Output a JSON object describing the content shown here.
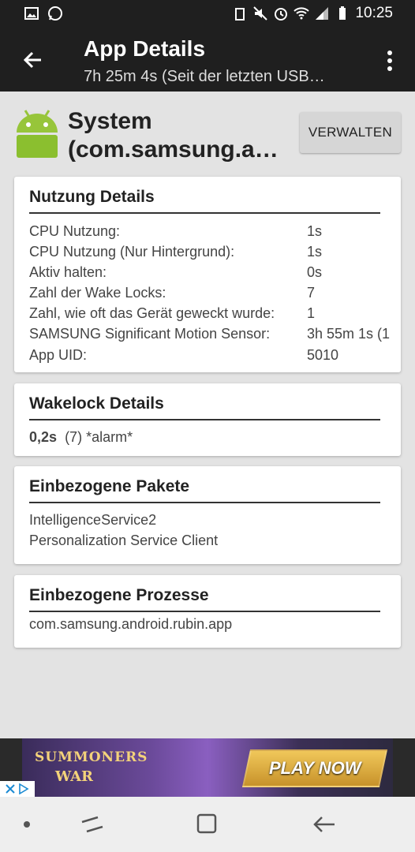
{
  "status": {
    "time": "10:25"
  },
  "appbar": {
    "title": "App Details",
    "subtitle": "7h 25m 4s (Seit der letzten USB…"
  },
  "header": {
    "name_line1": "System",
    "name_line2": "(com.samsung.a…",
    "manage_label": "VERWALTEN"
  },
  "usage": {
    "title": "Nutzung Details",
    "rows": [
      {
        "label": "CPU Nutzung:",
        "value": "1s"
      },
      {
        "label": "CPU Nutzung (Nur Hintergrund):",
        "value": "1s"
      },
      {
        "label": "Aktiv halten:",
        "value": "0s"
      },
      {
        "label": "Zahl der Wake Locks:",
        "value": "7"
      },
      {
        "label": "Zahl, wie oft das Gerät geweckt wurde:",
        "value": "1"
      },
      {
        "label": "SAMSUNG Significant Motion Sensor:",
        "value": "3h 55m 1s (1"
      },
      {
        "label": "App UID:",
        "value": "5010"
      }
    ]
  },
  "wakelock": {
    "title": "Wakelock Details",
    "time": "0,2s",
    "entry": "(7) *alarm*"
  },
  "packages": {
    "title": "Einbezogene Pakete",
    "items": [
      "IntelligenceService2",
      "Personalization Service Client"
    ]
  },
  "processes": {
    "title": "Einbezogene Prozesse",
    "items": [
      "com.samsung.android.rubin.app"
    ]
  },
  "ad": {
    "logo_line1": "SUMMONERS",
    "logo_line2": "WAR",
    "cta": "PLAY NOW"
  },
  "icons": {
    "back": "arrow-left-icon",
    "menu": "more-vert-icon",
    "app": "android-icon"
  }
}
